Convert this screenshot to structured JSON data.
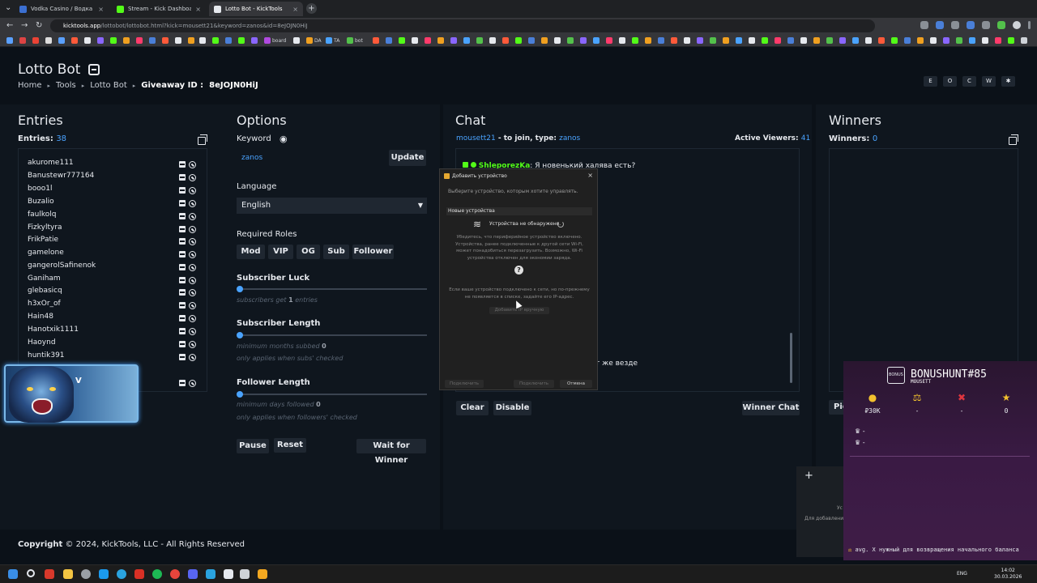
{
  "browser": {
    "tabs": [
      {
        "title": "Vodka Casino / Водка Казино",
        "fav": "#3b6fd1",
        "active": false
      },
      {
        "title": "Stream - Kick Dashboard",
        "fav": "#53fc18",
        "active": false
      },
      {
        "title": "Lotto Bot - KickTools",
        "fav": "#e6e9ee",
        "active": true
      }
    ],
    "url_host": "kicktools.app",
    "url_path": "/lottobot/lottobot.html?kick=mousett21&keyword=zanos&id=8eJOJN0HiJ",
    "bookmarks": [
      "board",
      "DA",
      "TA",
      "bot"
    ]
  },
  "header": {
    "title": "Lotto Bot",
    "breadcrumb": [
      "Home",
      "Tools",
      "Lotto Bot"
    ],
    "giveaway_label": "Giveaway ID :",
    "giveaway_id": "8eJOJN0HiJ",
    "top_buttons": [
      "E",
      "O",
      "C",
      "W",
      "✱"
    ]
  },
  "entries": {
    "title": "Entries",
    "label": "Entries:",
    "count": "38",
    "items": [
      "akurome111",
      "Banustewr777164",
      "booo1l",
      "Buzalio",
      "faulkolq",
      "Fizkyltyra",
      "FrikPatie",
      "gamelone",
      "gangerolSafinenok",
      "Ganiham",
      "glebasicq",
      "h3xOr_of",
      "Hain48",
      "Hanotxik1111",
      "Haoynd",
      "huntik391",
      ""
    ]
  },
  "options": {
    "title": "Options",
    "keyword_label": "Keyword",
    "keyword_value": "zanos",
    "update_label": "Update",
    "language_label": "Language",
    "language_value": "English",
    "roles_label": "Required Roles",
    "roles": [
      "Mod",
      "VIP",
      "OG",
      "Sub",
      "Follower"
    ],
    "sub_luck_label": "Subscriber Luck",
    "sub_luck_hint_a": "subscribers get",
    "sub_luck_value": "1",
    "sub_luck_hint_b": "entries",
    "sub_length_label": "Subscriber Length",
    "sub_length_hint_a": "minimum months subbed",
    "sub_length_value": "0",
    "sub_length_hint_b": "only applies when subs' checked",
    "follower_length_label": "Follower Length",
    "follower_length_hint_a": "minimum days followed",
    "follower_length_value": "0",
    "follower_length_hint_b": "only applies when followers' checked",
    "pause_label": "Pause",
    "reset_label": "Reset",
    "wait_label": "Wait for Winner"
  },
  "chat": {
    "title": "Chat",
    "join_user": "mousett21",
    "join_text": " - to join, type: ",
    "join_keyword": "zanos",
    "viewers_label": "Active Viewers:",
    "viewers_count": "41",
    "msg_user": "ShleporezKa",
    "msg_text": ": Я новенький халява есть?",
    "msg_tail": "т же везде",
    "clear_label": "Clear",
    "disable_label": "Disable",
    "winner_chat_label": "Winner Chat"
  },
  "winners": {
    "title": "Winners",
    "label": "Winners:",
    "count": "0",
    "pick_label": "Pic"
  },
  "dialog": {
    "title": "Добавить устройство",
    "subtitle": "Выберите устройство, которым хотите управлять.",
    "section": "Новые устройства",
    "status": "Устройства не обнаружено.",
    "para": "Убедитесь, что периферийное устройство включено. Устройства, ранее подключенные к другой сети Wi-Fi, может понадобиться перезагрузить. Возможно, Wi-Fi устройства отключен для экономии заряда.",
    "para2": "Если ваше устройство подключено к сети, но по-прежнему не появляется в списке, задайте его IP-адрес.",
    "add_manual": "Добавить IP вручную",
    "btn_a": "Подключить",
    "btn_b": "Подключить",
    "btn_cancel": "Отмена"
  },
  "overlay_bear": {
    "text": "V"
  },
  "bonushunt": {
    "icon_text": "BONUS",
    "title": "BONUSHUNT#85",
    "subtitle": "MOUSETT",
    "stats": [
      {
        "icon": "coin-icon",
        "glyph": "●",
        "color": "#f2c12e",
        "value": "₽30K"
      },
      {
        "icon": "balance-icon",
        "glyph": "⚖",
        "color": "#f2c12e",
        "value": "-"
      },
      {
        "icon": "cross-icon",
        "glyph": "✖",
        "color": "#e0363f",
        "value": "-"
      },
      {
        "icon": "star-icon",
        "glyph": "★",
        "color": "#f2c12e",
        "value": "0"
      }
    ],
    "rows": [
      "-",
      "-"
    ],
    "footer": "avg. X нужный для возвращения начального баланса"
  },
  "mini_panel": {
    "text1": "Ус",
    "text2": "Для добавлени"
  },
  "footer": {
    "copyright": "Copyright",
    "text": "© 2024, KickTools, LLC - All Rights Reserved"
  },
  "taskbar": {
    "lang": "ENG",
    "time": "14:02",
    "date": "30.03.2026"
  }
}
